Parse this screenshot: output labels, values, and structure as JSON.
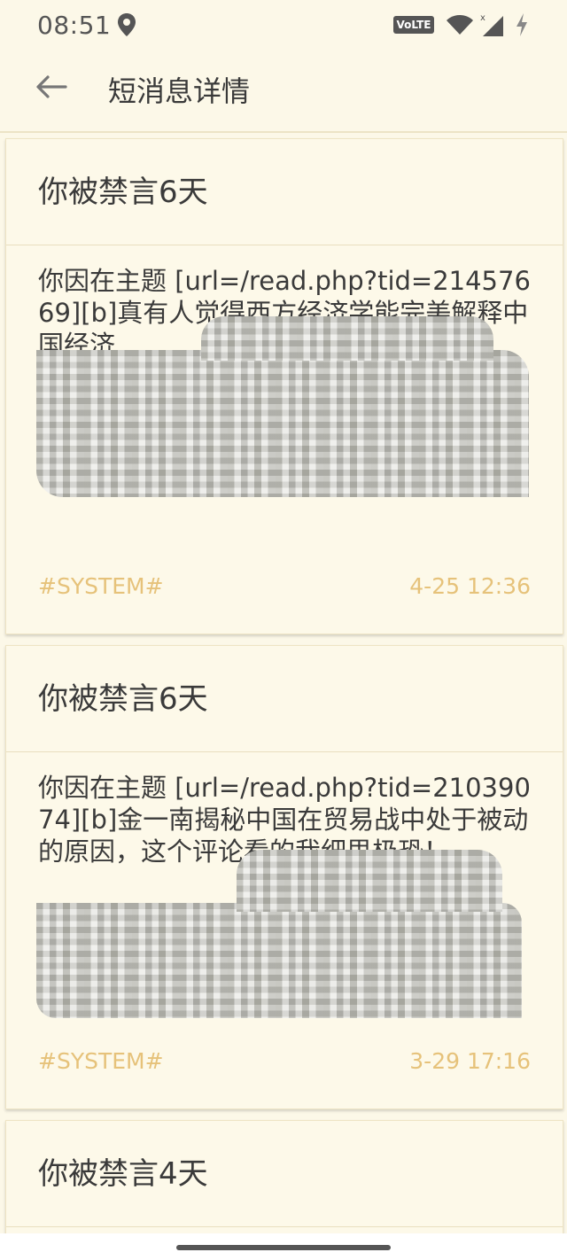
{
  "status_bar": {
    "time": "08:51",
    "network_badge": "VoLTE",
    "icons": [
      "location-icon",
      "wifi-icon",
      "signal-icon",
      "charging-icon"
    ]
  },
  "app_bar": {
    "title": "短消息详情",
    "back_icon": "arrow-left-icon"
  },
  "colors": {
    "background": "#fcf8e8",
    "accent": "#e6c27a",
    "text": "#3a3a3a"
  },
  "messages": [
    {
      "title": "你被禁言6天",
      "body": "你因在主题 [url=/read.php?tid=21457669][b]真有人觉得西方经济学能完美解释中国经济",
      "tag": "#SYSTEM#",
      "time": "4-25 12:36"
    },
    {
      "title": "你被禁言6天",
      "body": "你因在主题 [url=/read.php?tid=21039074][b]金一南揭秘中国在贸易战中处于被动的原因，这个评论看的我细思极恐！",
      "tag": "#SYSTEM#",
      "time": "3-29 17:16"
    },
    {
      "title": "你被禁言4天"
    }
  ]
}
